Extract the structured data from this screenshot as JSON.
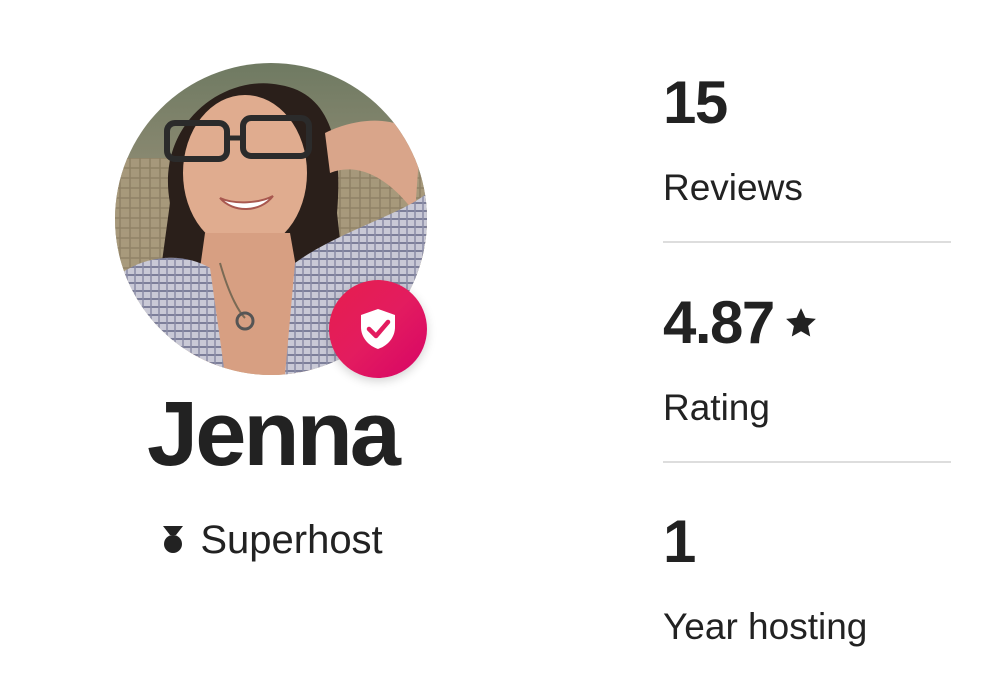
{
  "profile": {
    "name": "Jenna",
    "badge_label": "Superhost",
    "avatar_icon": "host-photo",
    "verified_icon": "shield-check-icon",
    "superhost_icon": "superhost-medal-icon",
    "accent_color": "#E31C5F"
  },
  "stats": {
    "reviews": {
      "value": "15",
      "label": "Reviews"
    },
    "rating": {
      "value": "4.87",
      "label": "Rating",
      "icon": "star-icon"
    },
    "hosting": {
      "value": "1",
      "label": "Year hosting"
    }
  }
}
